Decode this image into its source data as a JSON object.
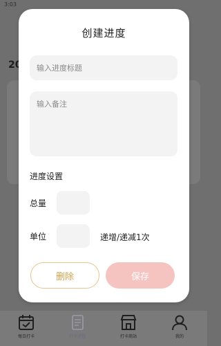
{
  "status_bar": {
    "time": "3:03"
  },
  "background": {
    "partial_text": "20"
  },
  "modal": {
    "title": "创建进度",
    "title_placeholder": "输入进度标题",
    "note_placeholder": "输入备注",
    "section_label": "进度设置",
    "total_label": "总量",
    "unit_label": "单位",
    "step_text": "递增/递减1次",
    "delete_label": "删除",
    "save_label": "保存"
  },
  "colors": {
    "delete_border": "#e7c48c",
    "delete_text": "#d6a24c",
    "save_bg": "#f6c4c0"
  },
  "nav": {
    "items": [
      {
        "label": "每日打卡",
        "icon": "calendar-check-icon"
      },
      {
        "label": "打卡进程",
        "icon": "document-icon"
      },
      {
        "label": "打卡商站",
        "icon": "store-icon"
      },
      {
        "label": "我的",
        "icon": "user-icon"
      }
    ]
  }
}
